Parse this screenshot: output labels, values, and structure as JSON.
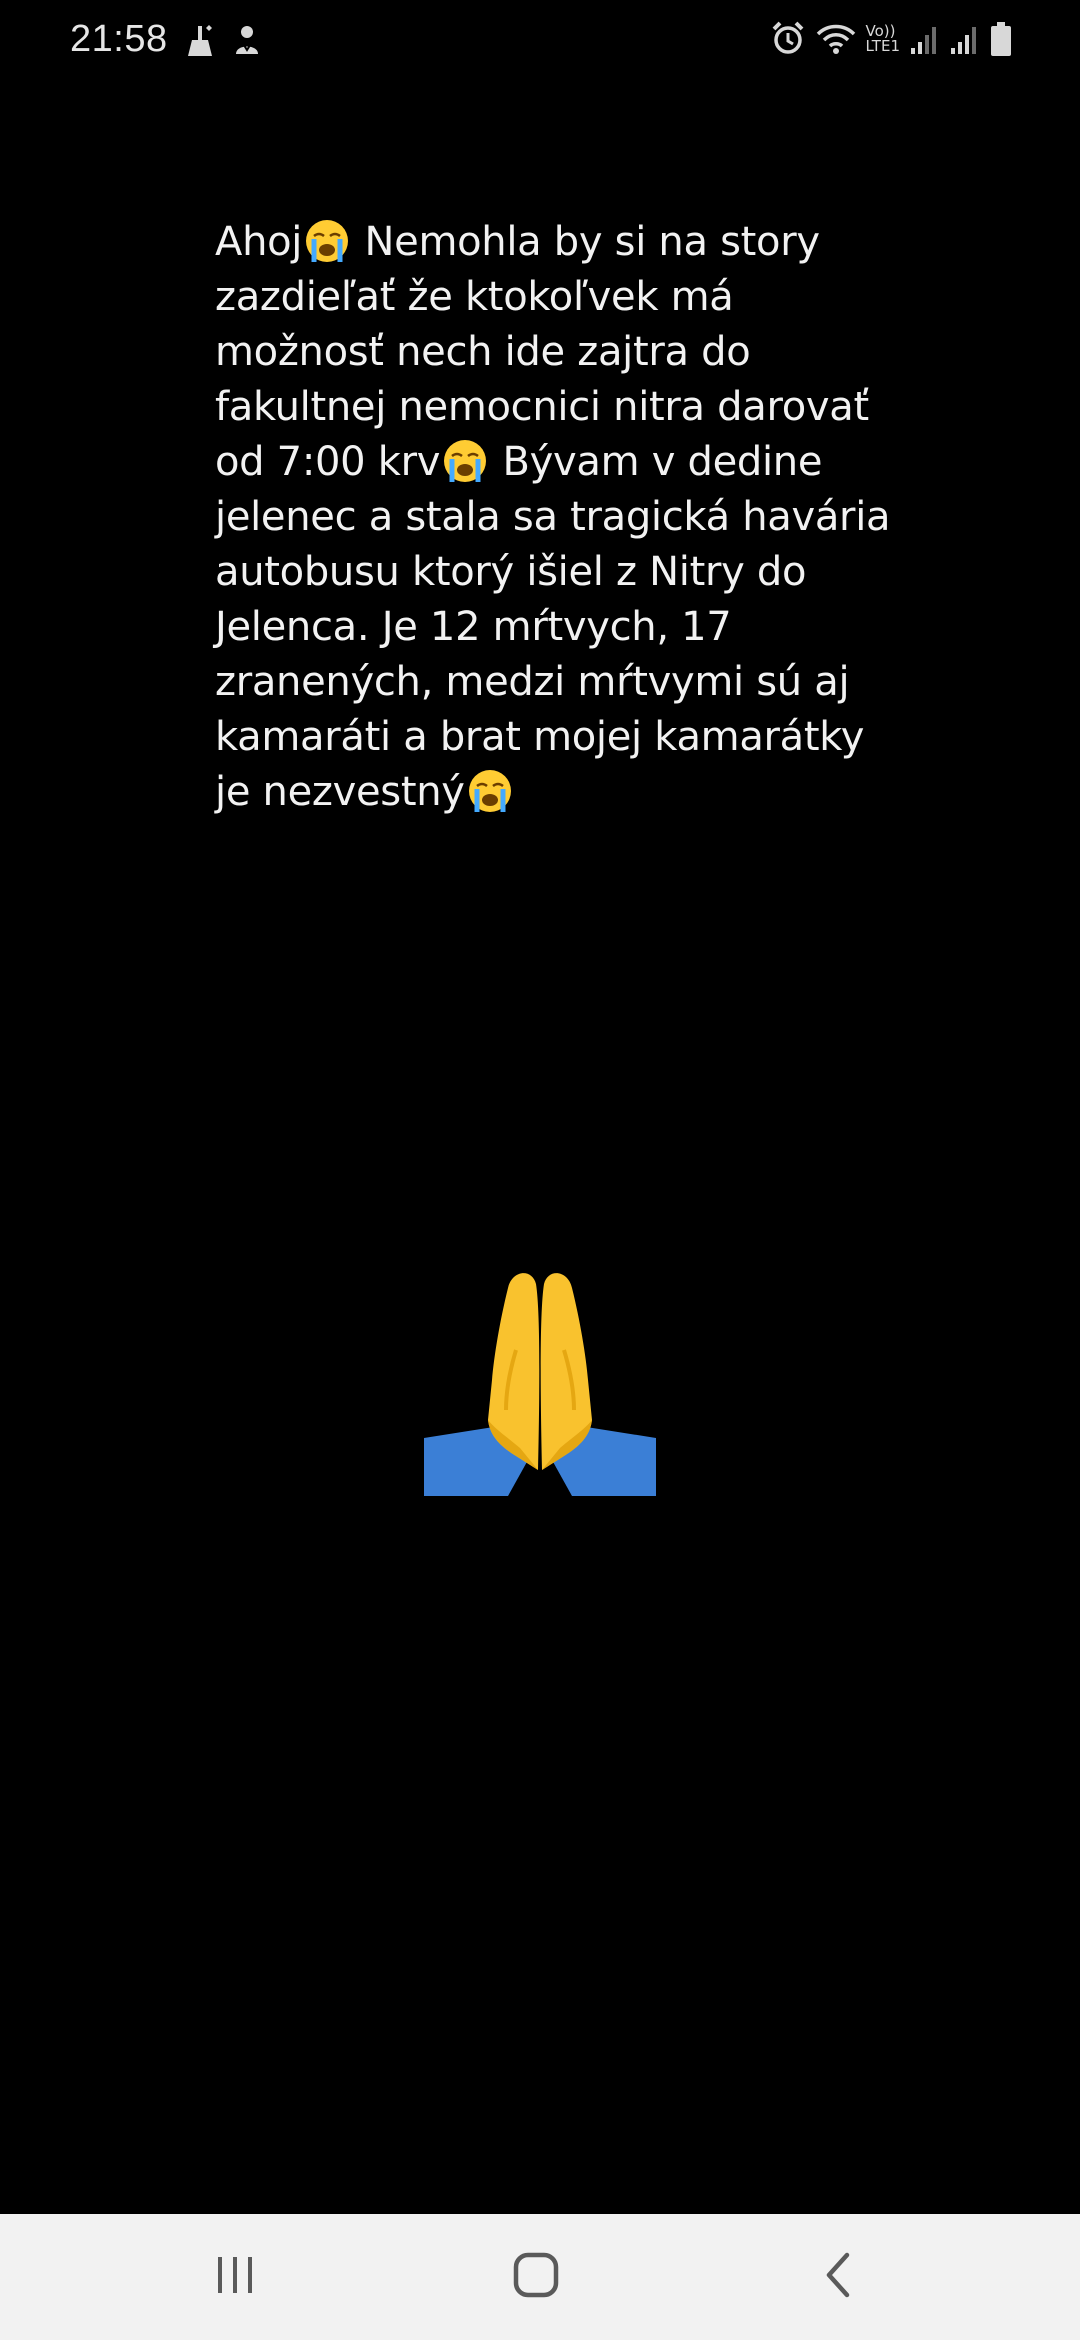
{
  "status_bar": {
    "time": "21:58",
    "left_icons": [
      "cleaner-icon",
      "notification-icon"
    ],
    "right_icons": [
      "alarm-icon",
      "wifi-icon",
      "volte-icon",
      "signal-1-icon",
      "signal-2-icon",
      "battery-icon"
    ],
    "volte_label_top": "Vo))",
    "volte_label_bottom": "LTE1"
  },
  "story": {
    "lines": [
      [
        "Ahoj",
        "😭",
        " Nemohla by si na story"
      ],
      [
        "zazdieľať že ktokoľvek má"
      ],
      [
        "možnosť nech ide zajtra do"
      ],
      [
        "fakultnej nemocnici nitra darovať"
      ],
      [
        "od 7:00 krv",
        "😭",
        " Bývam v dedine"
      ],
      [
        "jelenec a stala sa tragická havária"
      ],
      [
        "autobusu ktorý išiel z Nitry do"
      ],
      [
        "Jelenca. Je 12 mŕtvych, 17"
      ],
      [
        "zranených, medzi mŕtvymi sú aj"
      ],
      [
        "kamaráti a brat mojej kamarátky"
      ],
      [
        "je nezvestný",
        "😭"
      ]
    ],
    "text_color": "#f2f2f2",
    "background": "#000000"
  },
  "sticker": {
    "icon": "praying-hands-icon",
    "colors": {
      "hands": "#f9c22e",
      "sleeves": "#3b7fd6"
    }
  },
  "nav_bar": {
    "buttons": [
      "recent-apps-icon",
      "home-icon",
      "back-icon"
    ],
    "background": "#f2f2f2"
  }
}
